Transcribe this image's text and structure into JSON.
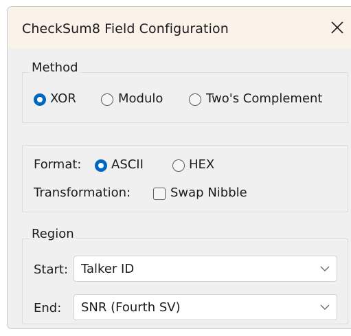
{
  "window": {
    "title": "CheckSum8 Field Configuration"
  },
  "method": {
    "legend": "Method",
    "options": [
      {
        "label": "XOR",
        "checked": true
      },
      {
        "label": "Modulo",
        "checked": false
      },
      {
        "label": "Two's Complement",
        "checked": false
      }
    ]
  },
  "format": {
    "label": "Format:",
    "options": [
      {
        "label": "ASCII",
        "checked": true
      },
      {
        "label": "HEX",
        "checked": false
      }
    ]
  },
  "transformation": {
    "label": "Transformation:",
    "checkbox_label": "Swap Nibble",
    "checked": false
  },
  "region": {
    "legend": "Region",
    "start_label": "Start:",
    "start_value": "Talker ID",
    "end_label": "End:",
    "end_value": "SNR (Fourth SV)"
  },
  "colors": {
    "accent": "#0067c0",
    "titlebar": "#fbf2ea",
    "background": "#f0f0f0"
  }
}
